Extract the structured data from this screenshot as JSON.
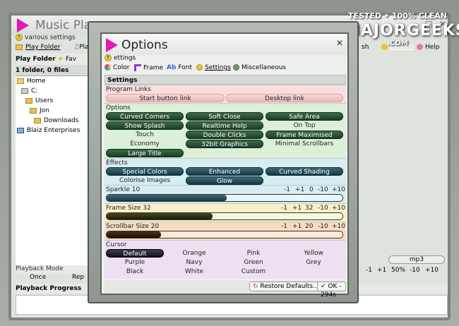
{
  "main": {
    "title": "Music Pla",
    "subtitle": "various settings",
    "tabs": [
      "Play Folder",
      "Fav",
      "Play"
    ],
    "right_tabs": [
      "sh",
      "Options",
      "Help"
    ],
    "panel_header": "Play Folder",
    "folder_info": "1 folder, 0 files",
    "tree": [
      "Home",
      "C:",
      "Users",
      "Jon",
      "Downloads",
      "Blaiz Enterprises"
    ],
    "playback_mode_label": "Playback Mode",
    "playback_mode_values": [
      "Once",
      "Rep"
    ],
    "playback_progress_label": "Playback Progress",
    "format_label": "mp3",
    "volume_controls": [
      "-1",
      "+1",
      "50%",
      "-10",
      "+10"
    ]
  },
  "watermark": {
    "line1": "TESTED • 100% CLEAN",
    "line2": "MAJORGEEKS",
    "line3": ".COM"
  },
  "options": {
    "title": "Options",
    "subtitle": "ettings",
    "tabs": [
      "Color",
      "Frame",
      "Font",
      "Settings",
      "Miscellaneous"
    ],
    "section_title": "Settings",
    "program_links": {
      "heading": "Program Links",
      "buttons": [
        "Start button link",
        "Desktop link"
      ]
    },
    "options_group": {
      "heading": "Options",
      "buttons": [
        "Curved Corners",
        "Soft Close",
        "Safe Area",
        "Show Splash",
        "Realtime Help",
        "On Top",
        "Touch",
        "Double Clicks",
        "Frame Maximised",
        "Economy",
        "32bit Graphics",
        "Minimal Scrollbars",
        "Large Title"
      ]
    },
    "effects": {
      "heading": "Effects",
      "buttons": [
        "Special Colors",
        "Enhanced",
        "Curved Shading",
        "Colorise Images",
        "Glow"
      ]
    },
    "sparkle": {
      "label": "Sparkle 10",
      "controls": [
        "-1",
        "+1",
        "0",
        "-10",
        "+10"
      ],
      "level": 0.51
    },
    "frame_size": {
      "label": "Frame Size 32",
      "controls": [
        "-1",
        "+1",
        "32",
        "-10",
        "+10"
      ],
      "level": 0.45
    },
    "scrollbar_size": {
      "label": "Scrollbar Size 20",
      "controls": [
        "-1",
        "+1",
        "20",
        "-10",
        "+10"
      ],
      "level": 0.23
    },
    "cursor": {
      "heading": "Cursor",
      "buttons": [
        "Default",
        "Orange",
        "Pink",
        "Yellow",
        "Purple",
        "Navy",
        "Green",
        "Grey",
        "Black",
        "White",
        "Custom"
      ]
    },
    "footer": {
      "restore": "Restore Defaults...",
      "ok": "OK - 294s"
    }
  },
  "colors": {
    "accent": "#e21cae",
    "dark_green": "#193f28",
    "teal": "#133a44",
    "pink_bg": "#f9dede",
    "green_bg": "#dcefd8",
    "blue_bg": "#d6edf2",
    "yellow_bg": "#f6f1c8",
    "orange_bg": "#f6dcc2",
    "violet_bg": "#ece0f1"
  }
}
